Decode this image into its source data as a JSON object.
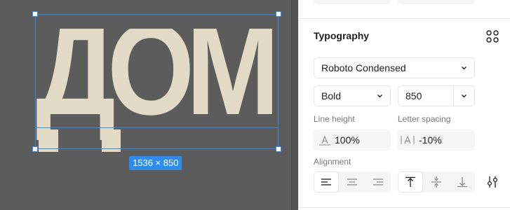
{
  "canvas": {
    "text_content": "ДОМ",
    "size_badge": "1536 × 850",
    "colors": {
      "background": "#5c5c5c",
      "text": "#e3dac6",
      "selection": "#2d8cf0"
    }
  },
  "typography": {
    "title": "Typography",
    "styles_icon": "four-dots-grid-icon",
    "font_family": "Roboto Condensed",
    "font_weight": "Bold",
    "font_size": "850",
    "line_height_label": "Line height",
    "line_height_value": "100%",
    "letter_spacing_label": "Letter spacing",
    "letter_spacing_value": "-10%",
    "alignment_label": "Alignment",
    "horizontal_align": [
      "left",
      "center",
      "right"
    ],
    "horizontal_selected": "left",
    "vertical_align": [
      "top",
      "middle",
      "bottom"
    ],
    "vertical_selected": "top",
    "more_icon": "type-settings-sliders-icon"
  }
}
